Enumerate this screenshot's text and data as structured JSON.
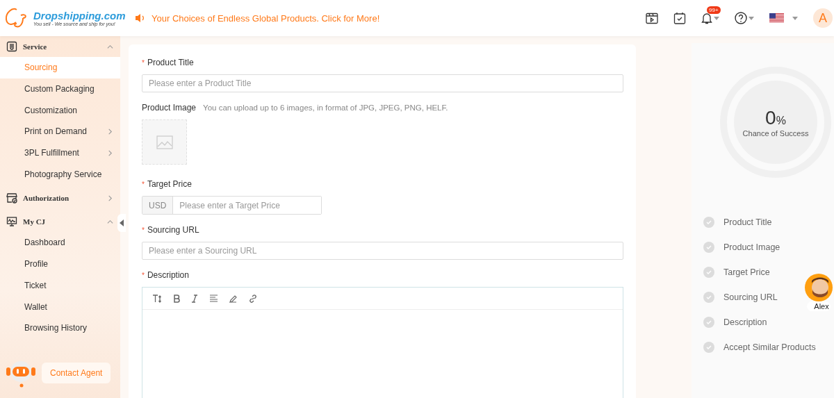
{
  "header": {
    "logo": {
      "name": "Dropshipping.com",
      "tagline": "You sell - We source and ship for you!"
    },
    "announcement": "Your Choices of Endless Global Products. Click for More!",
    "notifications": {
      "badge": "99+"
    },
    "avatar": {
      "initial": "A"
    }
  },
  "sidebar": {
    "groups": [
      {
        "label": "Service",
        "expanded": true,
        "items": [
          {
            "label": "Sourcing",
            "selected": true,
            "has_submenu": false
          },
          {
            "label": "Custom Packaging",
            "selected": false,
            "has_submenu": false
          },
          {
            "label": "Customization",
            "selected": false,
            "has_submenu": false
          },
          {
            "label": "Print on Demand",
            "selected": false,
            "has_submenu": true
          },
          {
            "label": "3PL Fulfillment",
            "selected": false,
            "has_submenu": true
          },
          {
            "label": "Photography Service",
            "selected": false,
            "has_submenu": false
          }
        ]
      },
      {
        "label": "Authorization",
        "expanded": false
      },
      {
        "label": "My CJ",
        "expanded": true,
        "items": [
          {
            "label": "Dashboard",
            "selected": false,
            "has_submenu": false
          },
          {
            "label": "Profile",
            "selected": false,
            "has_submenu": false
          },
          {
            "label": "Ticket",
            "selected": false,
            "has_submenu": false
          },
          {
            "label": "Wallet",
            "selected": false,
            "has_submenu": false
          },
          {
            "label": "Browsing History",
            "selected": false,
            "has_submenu": false
          }
        ]
      }
    ],
    "contact_button": "Contact Agent"
  },
  "form": {
    "fields": [
      {
        "kind": "text",
        "label": "Product Title",
        "required_mark": "*",
        "placeholder": "Please enter a Product Title"
      },
      {
        "kind": "image",
        "label": "Product Image",
        "hint": "You can upload up to 6 images, in format of JPG, JPEG, PNG, HELF."
      },
      {
        "kind": "price",
        "label": "Target Price",
        "required_mark": "*",
        "currency": "USD",
        "placeholder": "Please enter a Target Price"
      },
      {
        "kind": "text",
        "label": "Sourcing URL",
        "required_mark": "*",
        "placeholder": "Please enter a Sourcing URL"
      },
      {
        "kind": "editor",
        "label": "Description",
        "required_mark": "*"
      }
    ]
  },
  "progress": {
    "value": "0",
    "unit": "%",
    "caption": "Chance of Success",
    "checklist": [
      {
        "label": "Product Title",
        "checked": false
      },
      {
        "label": "Product Image",
        "checked": false
      },
      {
        "label": "Target Price",
        "checked": false
      },
      {
        "label": "Sourcing URL",
        "checked": false
      },
      {
        "label": "Description",
        "checked": false
      },
      {
        "label": "Accept Similar Products",
        "checked": false
      }
    ]
  },
  "agent": {
    "name": "Alex"
  }
}
